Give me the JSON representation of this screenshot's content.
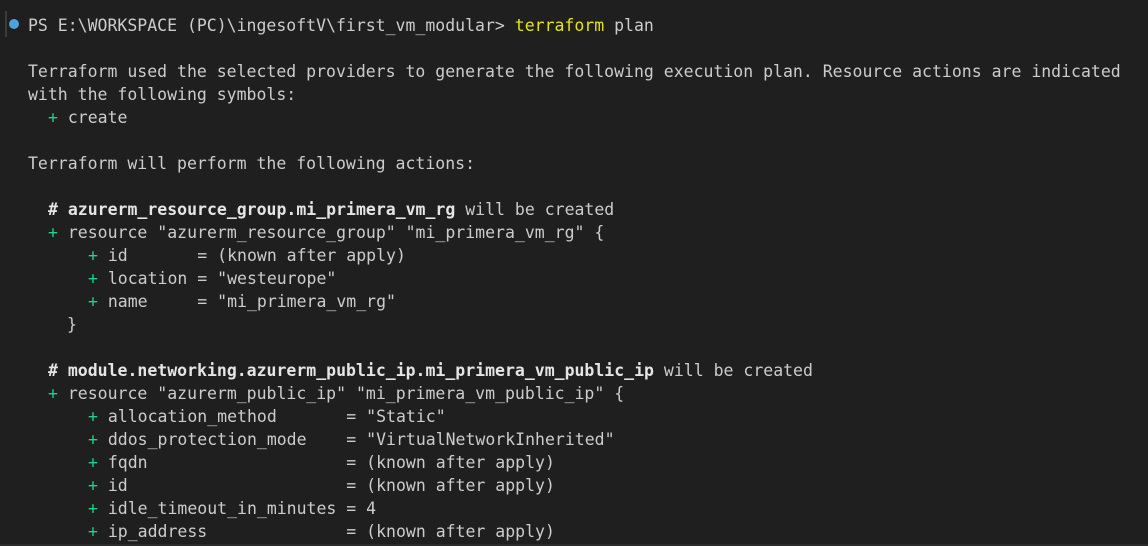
{
  "prompt": {
    "text": "PS E:\\WORKSPACE (PC)\\ingesoftV\\first_vm_modular> ",
    "command": "terraform",
    "args": " plan"
  },
  "output": {
    "intro_1": "Terraform used the selected providers to generate the following execution plan. Resource actions are indicated",
    "intro_2": "with the following symbols:",
    "symbol_plus": "+",
    "symbol_create": " create",
    "actions_header": "Terraform will perform the following actions:",
    "rg": {
      "hash": "# ",
      "name": "azurerm_resource_group.mi_primera_vm_rg",
      "suffix": " will be created",
      "resource_line": " resource \"azurerm_resource_group\" \"mi_primera_vm_rg\" {",
      "attrs": [
        " id       = (known after apply)",
        " location = \"westeurope\"",
        " name     = \"mi_primera_vm_rg\""
      ],
      "close": "}"
    },
    "pip": {
      "hash": "# ",
      "name": "module.networking.azurerm_public_ip.mi_primera_vm_public_ip",
      "suffix": " will be created",
      "resource_line": " resource \"azurerm_public_ip\" \"mi_primera_vm_public_ip\" {",
      "attrs": [
        " allocation_method       = \"Static\"",
        " ddos_protection_mode    = \"VirtualNetworkInherited\"",
        " fqdn                    = (known after apply)",
        " id                      = (known after apply)",
        " idle_timeout_in_minutes = 4",
        " ip_address              = (known after apply)"
      ]
    }
  },
  "colors": {
    "background": "#1f1f1f",
    "text": "#cccccc",
    "command": "#e5e510",
    "plus": "#23d18b",
    "dot": "#4aa3df"
  }
}
